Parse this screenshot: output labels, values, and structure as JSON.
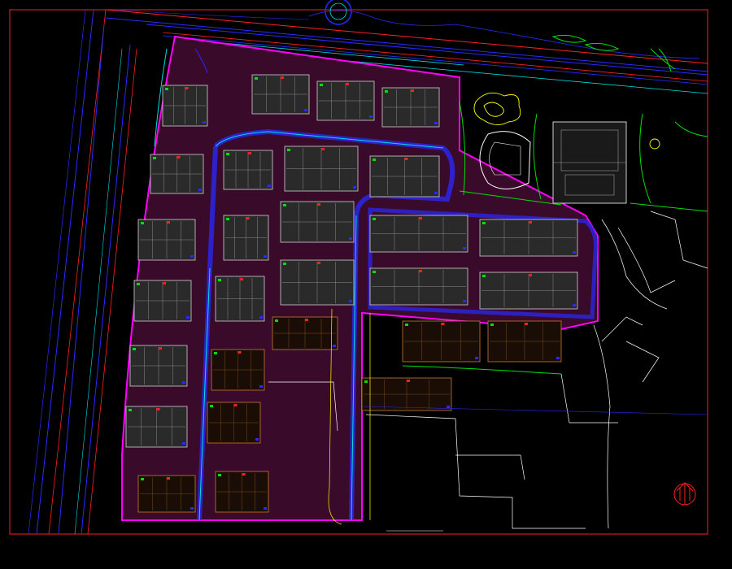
{
  "drawing": {
    "background": "#000000",
    "colors": {
      "frame": "#ff2020",
      "road_blue": "#2a2aff",
      "road_cyan": "#00e0e0",
      "green": "#00e000",
      "magenta": "#ff00ff",
      "pink_hatch": "#ff60c0",
      "orange": "#c87a2a",
      "white": "#ffffff",
      "yellow": "#ffff00",
      "gray": "#9a9a9a",
      "red": "#ff3030"
    }
  },
  "legend": {
    "title": "",
    "rows": [
      {
        "label": "",
        "value": "",
        "note": ""
      },
      {
        "label": "",
        "value": "",
        "note": ""
      },
      {
        "label": "",
        "value": "",
        "note": ""
      }
    ]
  },
  "north_arrow": {
    "icon": "north-arrow-icon"
  }
}
